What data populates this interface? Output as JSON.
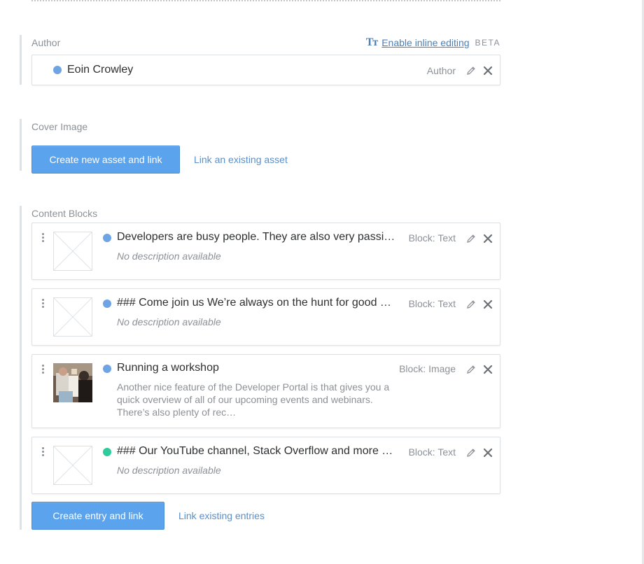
{
  "author_field": {
    "label": "Author",
    "inline_editing": {
      "icon": "text-format-icon",
      "icon_text": "Tт",
      "link_label": "Enable inline editing",
      "badge": "BETA"
    },
    "entry": {
      "title": "Eoin Crowley",
      "type": "Author",
      "status_color": "#6fa4e4"
    }
  },
  "cover_image_field": {
    "label": "Cover Image",
    "primary_button": "Create new asset and link",
    "secondary_link": "Link an existing asset"
  },
  "content_blocks_field": {
    "label": "Content Blocks",
    "items": [
      {
        "title": "Developers are busy people. They are also very passi…",
        "type": "Block: Text",
        "description": "No description available",
        "status_color": "#6fa4e4"
      },
      {
        "title": "### Come join us We’re always on the hunt for good …",
        "type": "Block: Text",
        "description": "No description available",
        "status_color": "#6fa4e4"
      },
      {
        "title": "Running a workshop",
        "type": "Block: Image",
        "description": "Another nice feature of the Developer Portal is that gives you a quick overview of all of our upcoming events and webinars. There’s also plenty of rec…",
        "status_color": "#6fa4e4"
      },
      {
        "title": "### Our YouTube channel, Stack Overflow and more …",
        "type": "Block: Text",
        "description": "No description available",
        "status_color": "#2dcc9a"
      }
    ],
    "primary_button": "Create entry and link",
    "secondary_link": "Link existing entries"
  },
  "colors": {
    "accent_blue": "#5ba3ec",
    "link_blue": "#5a8fc8",
    "published_green": "#2dcc9a",
    "draft_blue": "#6fa4e4",
    "muted_text": "#8c9197"
  }
}
